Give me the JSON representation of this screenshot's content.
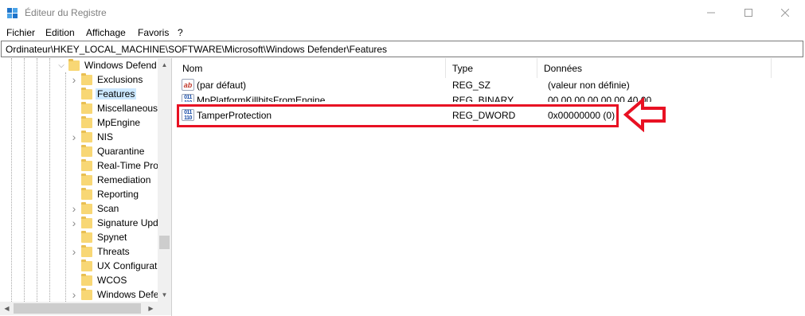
{
  "window": {
    "title": "Éditeur du Registre",
    "icon": "regedit-icon",
    "controls": [
      "minimize-icon",
      "maximize-icon",
      "close-icon"
    ]
  },
  "menu": [
    "Fichier",
    "Edition",
    "Affichage",
    "Favoris",
    "?"
  ],
  "address": "Ordinateur\\HKEY_LOCAL_MACHINE\\SOFTWARE\\Microsoft\\Windows Defender\\Features",
  "tree": {
    "parent": {
      "label": "Windows Defend",
      "expanded": true
    },
    "children": [
      {
        "label": "Exclusions",
        "has_children": true,
        "selected": false
      },
      {
        "label": "Features",
        "has_children": false,
        "selected": true
      },
      {
        "label": "Miscellaneous",
        "has_children": false,
        "selected": false
      },
      {
        "label": "MpEngine",
        "has_children": false,
        "selected": false
      },
      {
        "label": "NIS",
        "has_children": true,
        "selected": false
      },
      {
        "label": "Quarantine",
        "has_children": false,
        "selected": false
      },
      {
        "label": "Real-Time Prot",
        "has_children": false,
        "selected": false
      },
      {
        "label": "Remediation",
        "has_children": false,
        "selected": false
      },
      {
        "label": "Reporting",
        "has_children": false,
        "selected": false
      },
      {
        "label": "Scan",
        "has_children": true,
        "selected": false
      },
      {
        "label": "Signature Upd",
        "has_children": true,
        "selected": false
      },
      {
        "label": "Spynet",
        "has_children": false,
        "selected": false
      },
      {
        "label": "Threats",
        "has_children": true,
        "selected": false
      },
      {
        "label": "UX Configurati",
        "has_children": false,
        "selected": false
      },
      {
        "label": "WCOS",
        "has_children": false,
        "selected": false
      },
      {
        "label": "Windows Defe",
        "has_children": true,
        "selected": false
      }
    ]
  },
  "list": {
    "columns": [
      "Nom",
      "Type",
      "Données"
    ],
    "rows": [
      {
        "name": "(par défaut)",
        "type": "REG_SZ",
        "data": "(valeur non définie)",
        "icon": "string-value-icon"
      },
      {
        "name": "MpPlatformKillbitsFromEngine",
        "type": "REG_BINARY",
        "data": "00 00 00 00 00 00 40 00",
        "icon": "binary-value-icon"
      },
      {
        "name": "TamperProtection",
        "type": "REG_DWORD",
        "data": "0x00000000 (0)",
        "icon": "binary-value-icon"
      }
    ]
  },
  "annotation": {
    "highlight_color": "#e81123",
    "arrow_direction": "left"
  }
}
